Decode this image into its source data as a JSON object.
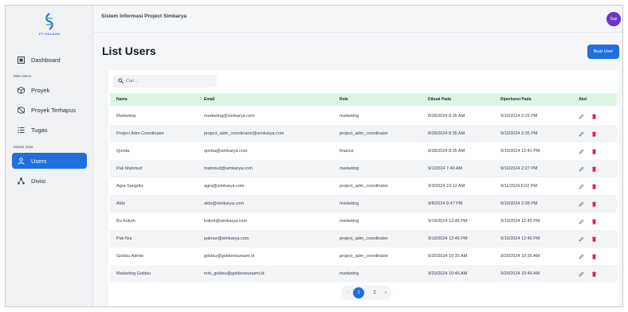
{
  "app": {
    "title": "Sistem Informasi Project Simkarya",
    "logo_text": "PT GOLSUN",
    "avatar_initials": "Sup"
  },
  "sidebar": {
    "dashboard": "Dashboard",
    "section_main": "Main Menu",
    "proyek": "Proyek",
    "proyek_terhapus": "Proyek Terhapus",
    "tugas": "Tugas",
    "section_master": "Master Data",
    "users": "Users",
    "divisi": "Divisi"
  },
  "page": {
    "title": "List Users",
    "add_button": "Buat User"
  },
  "search": {
    "placeholder": "Cari..."
  },
  "table": {
    "headers": {
      "name": "Nama",
      "email": "Email",
      "role": "Role",
      "created": "Dibuat Pada",
      "updated": "Diperbarui Pada",
      "actions": "Aksi"
    },
    "rows": [
      {
        "name": "Marketing",
        "email": "marketing@simkarya.com",
        "role": "marketing",
        "created": "8/28/2024 8:35 AM",
        "updated": "9/10/2024 2:25 PM"
      },
      {
        "name": "Project Adm Coordinator",
        "email": "project_adm_coordinator@simkarya.com",
        "role": "project_adm_coordinator",
        "created": "8/28/2024 8:35 AM",
        "updated": "9/10/2024 2:25 PM"
      },
      {
        "name": "Qonita",
        "email": "qonita@simkarya.com",
        "role": "finance",
        "created": "8/28/2024 8:35 AM",
        "updated": "9/19/2024 12:41 PM"
      },
      {
        "name": "Pak Mahmud",
        "email": "mahmud@simkarya.com",
        "role": "marketing",
        "created": "9/1/2024 7:40 AM",
        "updated": "9/10/2024 2:27 PM"
      },
      {
        "name": "Agra Sangrila",
        "email": "agra@simkarya.com",
        "role": "project_adm_coordinator",
        "created": "9/3/2024 10:12 AM",
        "updated": "9/11/2024 6:02 PM"
      },
      {
        "name": "Aldo",
        "email": "aldo@simkarya.com",
        "role": "marketing",
        "created": "9/8/2024 8:47 PM",
        "updated": "9/10/2024 2:28 PM"
      },
      {
        "name": "Bu Kokoh",
        "email": "kokoh@simkarya.com",
        "role": "marketing",
        "created": "9/19/2024 12:45 PM",
        "updated": "9/19/2024 12:45 PM"
      },
      {
        "name": "Pak Nur",
        "email": "paknur@simkarya.com",
        "role": "project_adm_coordinator",
        "created": "9/19/2024 12:46 PM",
        "updated": "9/19/2024 12:46 PM"
      },
      {
        "name": "Goldsu Admin",
        "email": "goldsu@goldentsunami.id",
        "role": "project_adm_coordinator",
        "created": "9/20/2024 10:35 AM",
        "updated": "9/20/2024 10:35 AM"
      },
      {
        "name": "Marketing Goldsu",
        "email": "mrk_goldsu@goldentsunami.id",
        "role": "marketing",
        "created": "9/20/2024 10:46 AM",
        "updated": "9/20/2024 10:46 AM"
      }
    ]
  },
  "pagination": {
    "page1": "1",
    "page2": "2"
  },
  "colors": {
    "accent": "#1f6fe0",
    "header_row": "#dff5e4",
    "delete": "#e11d48",
    "avatar": "#6b35c9"
  }
}
